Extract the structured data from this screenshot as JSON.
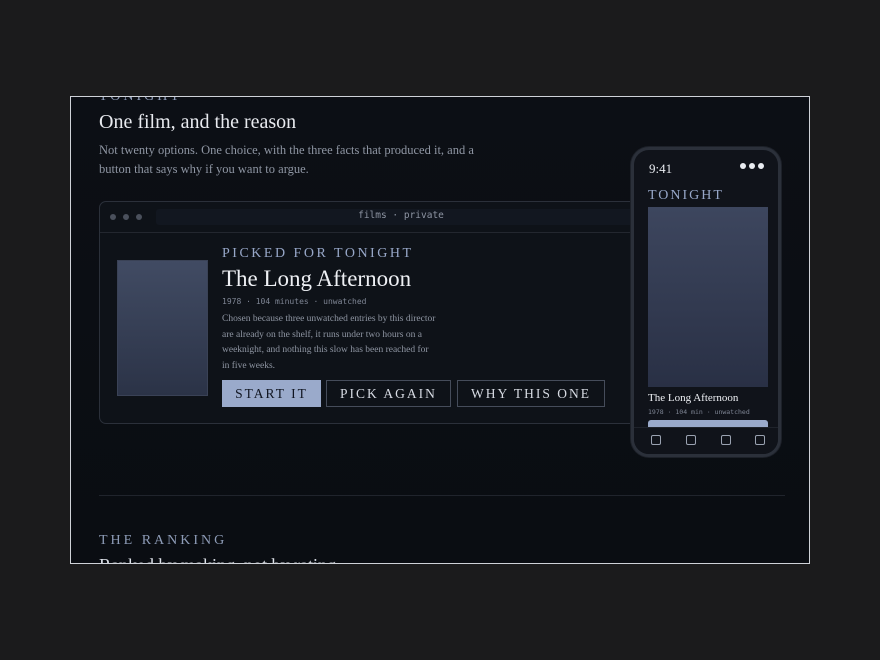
{
  "header": {
    "eyebrow": "TONIGHT",
    "title": "One film, and the reason",
    "description": "Not twenty options. One choice, with the three facts that produced it, and a button that says why if you want to argue."
  },
  "window": {
    "url": "films · private"
  },
  "pick": {
    "label": "PICKED FOR TONIGHT",
    "title": "The Long Afternoon",
    "meta": "1978 · 104 minutes · unwatched",
    "reason": "Chosen because three unwatched entries by this director are already on the shelf, it runs under two hours on a weeknight, and nothing this slow has been reached for in five weeks.",
    "buttons": {
      "start": "START IT",
      "again": "PICK AGAIN",
      "why": "WHY THIS ONE"
    }
  },
  "phone": {
    "time": "9:41",
    "section": "TONIGHT",
    "title": "The Long Afternoon",
    "meta": "1978 · 104 min · unwatched",
    "nav_icons": [
      "tab-icon",
      "tab-icon",
      "tab-icon",
      "tab-icon"
    ]
  },
  "ranking": {
    "eyebrow": "THE RANKING",
    "title": "Ranked by making, not by rating"
  },
  "colors": {
    "accent": "#9aaacb",
    "background": "#0b0e13",
    "text": "#e8eaef",
    "muted": "#8f96a3"
  }
}
